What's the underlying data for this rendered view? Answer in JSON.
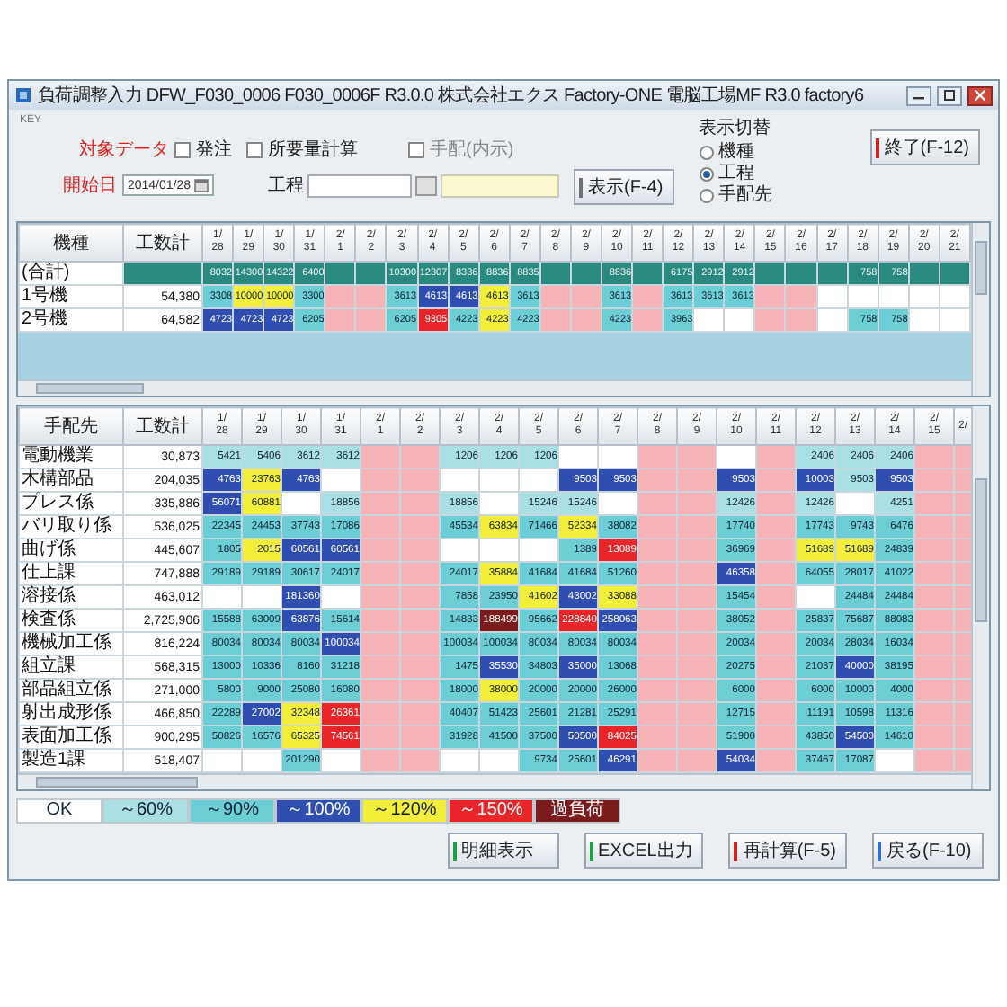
{
  "window": {
    "title": "負荷調整入力 DFW_F030_0006 F030_0006F R3.0.0 株式会社エクス Factory-ONE 電脳工場MF R3.0 factory6"
  },
  "form": {
    "key_label": "KEY",
    "target": {
      "label": "対象データ",
      "option": {
        "label": "発注",
        "checked": false
      }
    },
    "start_date": {
      "label": "開始日",
      "value": "2014/01/28"
    },
    "requirement": {
      "label": "所要量計算",
      "checked": false
    },
    "arrangement": {
      "label": "手配(内示)",
      "checked": false
    },
    "process": {
      "label": "工程"
    },
    "show_button": {
      "label": "表示(F-4)",
      "color": "#707070"
    },
    "display_toggle": {
      "title": "表示切替",
      "options": [
        {
          "label": "機種",
          "selected": false
        },
        {
          "label": "工程",
          "selected": true
        },
        {
          "label": "手配先",
          "selected": false
        }
      ]
    },
    "exit_button": {
      "label": "終了(F-12)",
      "color": "#d02020"
    }
  },
  "upper_table": {
    "columns": {
      "name": "機種",
      "total": "工数計",
      "dates": [
        "1/28",
        "1/29",
        "1/30",
        "1/31",
        "2/1",
        "2/2",
        "2/3",
        "2/4",
        "2/5",
        "2/6",
        "2/7",
        "2/8",
        "2/9",
        "2/10",
        "2/11",
        "2/12",
        "2/13",
        "2/14",
        "2/15",
        "2/16",
        "2/17",
        "2/18",
        "2/19",
        "2/20",
        "2/21"
      ]
    },
    "rows": [
      {
        "kind": "summary",
        "name": "(合計)",
        "cells": [
          {
            "kind": "sum",
            "text": "8032"
          },
          {
            "kind": "sum",
            "text": "14300"
          },
          {
            "kind": "sum",
            "text": "14322"
          },
          {
            "kind": "sum",
            "text": "6400"
          },
          {
            "kind": "sum"
          },
          {
            "kind": "sum"
          },
          {
            "kind": "sum",
            "text": "10300"
          },
          {
            "kind": "sum",
            "text": "12307"
          },
          {
            "kind": "sum",
            "text": "8336"
          },
          {
            "kind": "sum",
            "text": "8836"
          },
          {
            "kind": "sum",
            "text": "8835"
          },
          {
            "kind": "sum"
          },
          {
            "kind": "sum"
          },
          {
            "kind": "sum",
            "text": "8836"
          },
          {
            "kind": "sum"
          },
          {
            "kind": "sum",
            "text": "6175"
          },
          {
            "kind": "sum",
            "text": "2912"
          },
          {
            "kind": "sum",
            "text": "2912"
          },
          {
            "kind": "sum"
          },
          {
            "kind": "sum"
          },
          {
            "kind": "sum"
          },
          {
            "kind": "sum",
            "text": "758"
          },
          {
            "kind": "sum",
            "text": "758"
          },
          {
            "kind": "sum"
          },
          {
            "kind": "sum"
          }
        ]
      },
      {
        "kind": "item",
        "name": "1号機",
        "total": "54,380",
        "cells": [
          {
            "kind": "cyan",
            "text": "3308"
          },
          {
            "kind": "yellow",
            "text": "10000"
          },
          {
            "kind": "yellow",
            "text": "10000"
          },
          {
            "kind": "cyan",
            "text": "3300"
          },
          {
            "kind": "holiday"
          },
          {
            "kind": "holiday"
          },
          {
            "kind": "cyan",
            "text": "3613"
          },
          {
            "kind": "blue",
            "text": "4613"
          },
          {
            "kind": "blue",
            "text": "4613"
          },
          {
            "kind": "yellow",
            "text": "4613"
          },
          {
            "kind": "cyan",
            "text": "3613"
          },
          {
            "kind": "holiday"
          },
          {
            "kind": "holiday"
          },
          {
            "kind": "cyan",
            "text": "3613"
          },
          {
            "kind": "holiday"
          },
          {
            "kind": "cyan",
            "text": "3613"
          },
          {
            "kind": "cyan",
            "text": "3613"
          },
          {
            "kind": "cyan",
            "text": "3613"
          },
          {
            "kind": "holiday"
          },
          {
            "kind": "holiday"
          },
          {
            "kind": "blank"
          },
          {
            "kind": "blank"
          },
          {
            "kind": "blank"
          },
          {
            "kind": "blank"
          },
          {
            "kind": "blank"
          }
        ]
      },
      {
        "kind": "item",
        "name": "2号機",
        "total": "64,582",
        "cells": [
          {
            "kind": "blue",
            "text": "4723"
          },
          {
            "kind": "blue",
            "text": "4723"
          },
          {
            "kind": "blue",
            "text": "4723"
          },
          {
            "kind": "cyan",
            "text": "6205"
          },
          {
            "kind": "holiday"
          },
          {
            "kind": "holiday"
          },
          {
            "kind": "cyan",
            "text": "6205"
          },
          {
            "kind": "red",
            "text": "9305"
          },
          {
            "kind": "cyan",
            "text": "4223"
          },
          {
            "kind": "yellow",
            "text": "4223"
          },
          {
            "kind": "cyan",
            "text": "4223"
          },
          {
            "kind": "holiday"
          },
          {
            "kind": "holiday"
          },
          {
            "kind": "cyan",
            "text": "4223"
          },
          {
            "kind": "holiday"
          },
          {
            "kind": "cyan",
            "text": "3963"
          },
          {
            "kind": "blank"
          },
          {
            "kind": "blank"
          },
          {
            "kind": "holiday"
          },
          {
            "kind": "holiday"
          },
          {
            "kind": "blank"
          },
          {
            "kind": "cyan",
            "text": "758"
          },
          {
            "kind": "cyan",
            "text": "758"
          },
          {
            "kind": "blank"
          },
          {
            "kind": "blank"
          }
        ]
      }
    ]
  },
  "lower_table": {
    "columns": {
      "name": "手配先",
      "total": "工数計",
      "dates": [
        "1/28",
        "1/29",
        "1/30",
        "1/31",
        "2/1",
        "2/2",
        "2/3",
        "2/4",
        "2/5",
        "2/6",
        "2/7",
        "2/8",
        "2/9",
        "2/10",
        "2/11",
        "2/12",
        "2/13",
        "2/14",
        "2/15",
        "2/"
      ]
    },
    "rows": [
      {
        "name": "電動機業",
        "total": "30,873",
        "cells": [
          {
            "kind": "light",
            "text": "5421"
          },
          {
            "kind": "light",
            "text": "5406"
          },
          {
            "kind": "light",
            "text": "3612"
          },
          {
            "kind": "light",
            "text": "3612"
          },
          {
            "kind": "holiday"
          },
          {
            "kind": "holiday"
          },
          {
            "kind": "light",
            "text": "1206"
          },
          {
            "kind": "light",
            "text": "1206"
          },
          {
            "kind": "light",
            "text": "1206"
          },
          {
            "kind": "blank"
          },
          {
            "kind": "blank"
          },
          {
            "kind": "holiday"
          },
          {
            "kind": "holiday"
          },
          {
            "kind": "blank"
          },
          {
            "kind": "holiday"
          },
          {
            "kind": "light",
            "text": "2406"
          },
          {
            "kind": "light",
            "text": "2406"
          },
          {
            "kind": "light",
            "text": "2406"
          },
          {
            "kind": "holiday"
          },
          {
            "kind": "holiday"
          }
        ]
      },
      {
        "name": "木構部品",
        "total": "204,035",
        "cells": [
          {
            "kind": "blue",
            "text": "4763"
          },
          {
            "kind": "yellow",
            "text": "23763"
          },
          {
            "kind": "blue",
            "text": "4763"
          },
          {
            "kind": "blank"
          },
          {
            "kind": "holiday"
          },
          {
            "kind": "holiday"
          },
          {
            "kind": "blank"
          },
          {
            "kind": "blank"
          },
          {
            "kind": "blank"
          },
          {
            "kind": "blue",
            "text": "9503"
          },
          {
            "kind": "blue",
            "text": "9503"
          },
          {
            "kind": "holiday"
          },
          {
            "kind": "holiday"
          },
          {
            "kind": "blue",
            "text": "9503"
          },
          {
            "kind": "holiday"
          },
          {
            "kind": "blue",
            "text": "10003"
          },
          {
            "kind": "light",
            "text": "9503"
          },
          {
            "kind": "blue",
            "text": "9503"
          },
          {
            "kind": "holiday"
          },
          {
            "kind": "holiday"
          }
        ]
      },
      {
        "name": "プレス係",
        "total": "335,886",
        "cells": [
          {
            "kind": "blue",
            "text": "56071"
          },
          {
            "kind": "yellow",
            "text": "60881"
          },
          {
            "kind": "blank"
          },
          {
            "kind": "light",
            "text": "18856"
          },
          {
            "kind": "holiday"
          },
          {
            "kind": "holiday"
          },
          {
            "kind": "light",
            "text": "18856"
          },
          {
            "kind": "blank"
          },
          {
            "kind": "light",
            "text": "15246"
          },
          {
            "kind": "light",
            "text": "15246"
          },
          {
            "kind": "blank"
          },
          {
            "kind": "holiday"
          },
          {
            "kind": "holiday"
          },
          {
            "kind": "light",
            "text": "12426"
          },
          {
            "kind": "holiday"
          },
          {
            "kind": "light",
            "text": "12426"
          },
          {
            "kind": "blank"
          },
          {
            "kind": "light",
            "text": "4251"
          },
          {
            "kind": "holiday"
          },
          {
            "kind": "holiday"
          }
        ]
      },
      {
        "name": "バリ取り係",
        "total": "536,025",
        "cells": [
          {
            "kind": "cyan",
            "text": "22345"
          },
          {
            "kind": "cyan",
            "text": "24453"
          },
          {
            "kind": "cyan",
            "text": "37743"
          },
          {
            "kind": "cyan",
            "text": "17086"
          },
          {
            "kind": "holiday"
          },
          {
            "kind": "holiday"
          },
          {
            "kind": "cyan",
            "text": "45534"
          },
          {
            "kind": "yellow",
            "text": "63834"
          },
          {
            "kind": "cyan",
            "text": "71466"
          },
          {
            "kind": "yellow",
            "text": "52334"
          },
          {
            "kind": "cyan",
            "text": "38082"
          },
          {
            "kind": "holiday"
          },
          {
            "kind": "holiday"
          },
          {
            "kind": "cyan",
            "text": "17740"
          },
          {
            "kind": "holiday"
          },
          {
            "kind": "cyan",
            "text": "17743"
          },
          {
            "kind": "cyan",
            "text": "9743"
          },
          {
            "kind": "cyan",
            "text": "6476"
          },
          {
            "kind": "holiday"
          },
          {
            "kind": "holiday"
          }
        ]
      },
      {
        "name": "曲げ係",
        "total": "445,607",
        "cells": [
          {
            "kind": "cyan",
            "text": "1805"
          },
          {
            "kind": "yellow",
            "text": "2015"
          },
          {
            "kind": "blue",
            "text": "60561"
          },
          {
            "kind": "blue",
            "text": "60561"
          },
          {
            "kind": "holiday"
          },
          {
            "kind": "holiday"
          },
          {
            "kind": "blank"
          },
          {
            "kind": "blank"
          },
          {
            "kind": "blank"
          },
          {
            "kind": "cyan",
            "text": "1389"
          },
          {
            "kind": "red",
            "text": "13089"
          },
          {
            "kind": "holiday"
          },
          {
            "kind": "holiday"
          },
          {
            "kind": "cyan",
            "text": "36969"
          },
          {
            "kind": "holiday"
          },
          {
            "kind": "yellow",
            "text": "51689"
          },
          {
            "kind": "yellow",
            "text": "51689"
          },
          {
            "kind": "cyan",
            "text": "24839"
          },
          {
            "kind": "holiday"
          },
          {
            "kind": "holiday"
          }
        ]
      },
      {
        "name": "仕上課",
        "total": "747,888",
        "cells": [
          {
            "kind": "cyan",
            "text": "29189"
          },
          {
            "kind": "cyan",
            "text": "29189"
          },
          {
            "kind": "cyan",
            "text": "30617"
          },
          {
            "kind": "cyan",
            "text": "24017"
          },
          {
            "kind": "holiday"
          },
          {
            "kind": "holiday"
          },
          {
            "kind": "cyan",
            "text": "24017"
          },
          {
            "kind": "yellow",
            "text": "35884"
          },
          {
            "kind": "cyan",
            "text": "41684"
          },
          {
            "kind": "cyan",
            "text": "41684"
          },
          {
            "kind": "cyan",
            "text": "51260"
          },
          {
            "kind": "holiday"
          },
          {
            "kind": "holiday"
          },
          {
            "kind": "blue",
            "text": "46358"
          },
          {
            "kind": "holiday"
          },
          {
            "kind": "cyan",
            "text": "64055"
          },
          {
            "kind": "cyan",
            "text": "28017"
          },
          {
            "kind": "cyan",
            "text": "41022"
          },
          {
            "kind": "holiday"
          },
          {
            "kind": "holiday"
          }
        ]
      },
      {
        "name": "溶接係",
        "total": "463,012",
        "cells": [
          {
            "kind": "blank"
          },
          {
            "kind": "blank"
          },
          {
            "kind": "blue",
            "text": "181360"
          },
          {
            "kind": "blank"
          },
          {
            "kind": "holiday"
          },
          {
            "kind": "holiday"
          },
          {
            "kind": "cyan",
            "text": "7858"
          },
          {
            "kind": "cyan",
            "text": "23950"
          },
          {
            "kind": "yellow",
            "text": "41602"
          },
          {
            "kind": "blue",
            "text": "43002"
          },
          {
            "kind": "yellow",
            "text": "33088"
          },
          {
            "kind": "holiday"
          },
          {
            "kind": "holiday"
          },
          {
            "kind": "cyan",
            "text": "15454"
          },
          {
            "kind": "holiday"
          },
          {
            "kind": "blank"
          },
          {
            "kind": "cyan",
            "text": "24484"
          },
          {
            "kind": "cyan",
            "text": "24484"
          },
          {
            "kind": "holiday"
          },
          {
            "kind": "holiday"
          }
        ]
      },
      {
        "name": "検査係",
        "total": "2,725,906",
        "cells": [
          {
            "kind": "cyan",
            "text": "15588"
          },
          {
            "kind": "cyan",
            "text": "63009"
          },
          {
            "kind": "blue",
            "text": "63876"
          },
          {
            "kind": "cyan",
            "text": "15614"
          },
          {
            "kind": "holiday"
          },
          {
            "kind": "holiday"
          },
          {
            "kind": "cyan",
            "text": "14833"
          },
          {
            "kind": "over",
            "text": "188499"
          },
          {
            "kind": "cyan",
            "text": "95662"
          },
          {
            "kind": "red",
            "text": "228840"
          },
          {
            "kind": "blue",
            "text": "258063"
          },
          {
            "kind": "holiday"
          },
          {
            "kind": "holiday"
          },
          {
            "kind": "cyan",
            "text": "38052"
          },
          {
            "kind": "holiday"
          },
          {
            "kind": "cyan",
            "text": "25837"
          },
          {
            "kind": "cyan",
            "text": "75687"
          },
          {
            "kind": "cyan",
            "text": "88083"
          },
          {
            "kind": "holiday"
          },
          {
            "kind": "holiday"
          }
        ]
      },
      {
        "name": "機械加工係",
        "total": "816,224",
        "cells": [
          {
            "kind": "cyan",
            "text": "80034"
          },
          {
            "kind": "cyan",
            "text": "80034"
          },
          {
            "kind": "cyan",
            "text": "80034"
          },
          {
            "kind": "blue",
            "text": "100034"
          },
          {
            "kind": "holiday"
          },
          {
            "kind": "holiday"
          },
          {
            "kind": "cyan",
            "text": "100034"
          },
          {
            "kind": "cyan",
            "text": "100034"
          },
          {
            "kind": "cyan",
            "text": "80034"
          },
          {
            "kind": "cyan",
            "text": "80034"
          },
          {
            "kind": "cyan",
            "text": "80034"
          },
          {
            "kind": "holiday"
          },
          {
            "kind": "holiday"
          },
          {
            "kind": "cyan",
            "text": "20034"
          },
          {
            "kind": "holiday"
          },
          {
            "kind": "cyan",
            "text": "20034"
          },
          {
            "kind": "cyan",
            "text": "28034"
          },
          {
            "kind": "cyan",
            "text": "16034"
          },
          {
            "kind": "holiday"
          },
          {
            "kind": "holiday"
          }
        ]
      },
      {
        "name": "組立課",
        "total": "568,315",
        "cells": [
          {
            "kind": "cyan",
            "text": "13000"
          },
          {
            "kind": "cyan",
            "text": "10336"
          },
          {
            "kind": "cyan",
            "text": "8160"
          },
          {
            "kind": "cyan",
            "text": "31218"
          },
          {
            "kind": "holiday"
          },
          {
            "kind": "holiday"
          },
          {
            "kind": "cyan",
            "text": "1475"
          },
          {
            "kind": "blue",
            "text": "35530"
          },
          {
            "kind": "cyan",
            "text": "34803"
          },
          {
            "kind": "blue",
            "text": "35000"
          },
          {
            "kind": "cyan",
            "text": "13068"
          },
          {
            "kind": "holiday"
          },
          {
            "kind": "holiday"
          },
          {
            "kind": "cyan",
            "text": "20275"
          },
          {
            "kind": "holiday"
          },
          {
            "kind": "cyan",
            "text": "21037"
          },
          {
            "kind": "blue",
            "text": "40000"
          },
          {
            "kind": "cyan",
            "text": "38195"
          },
          {
            "kind": "holiday"
          },
          {
            "kind": "holiday"
          }
        ]
      },
      {
        "name": "部品組立係",
        "total": "271,000",
        "cells": [
          {
            "kind": "cyan",
            "text": "5800"
          },
          {
            "kind": "cyan",
            "text": "9000"
          },
          {
            "kind": "cyan",
            "text": "25080"
          },
          {
            "kind": "cyan",
            "text": "16080"
          },
          {
            "kind": "holiday"
          },
          {
            "kind": "holiday"
          },
          {
            "kind": "cyan",
            "text": "18000"
          },
          {
            "kind": "yellow",
            "text": "38000"
          },
          {
            "kind": "cyan",
            "text": "20000"
          },
          {
            "kind": "cyan",
            "text": "20000"
          },
          {
            "kind": "cyan",
            "text": "26000"
          },
          {
            "kind": "holiday"
          },
          {
            "kind": "holiday"
          },
          {
            "kind": "cyan",
            "text": "6000"
          },
          {
            "kind": "holiday"
          },
          {
            "kind": "cyan",
            "text": "6000"
          },
          {
            "kind": "cyan",
            "text": "10000"
          },
          {
            "kind": "cyan",
            "text": "4000"
          },
          {
            "kind": "holiday"
          },
          {
            "kind": "holiday"
          }
        ]
      },
      {
        "name": "射出成形係",
        "total": "466,850",
        "cells": [
          {
            "kind": "cyan",
            "text": "22289"
          },
          {
            "kind": "blue",
            "text": "27002"
          },
          {
            "kind": "yellow",
            "text": "32348"
          },
          {
            "kind": "red",
            "text": "26361"
          },
          {
            "kind": "holiday"
          },
          {
            "kind": "holiday"
          },
          {
            "kind": "cyan",
            "text": "40407"
          },
          {
            "kind": "cyan",
            "text": "51423"
          },
          {
            "kind": "cyan",
            "text": "25601"
          },
          {
            "kind": "cyan",
            "text": "21281"
          },
          {
            "kind": "cyan",
            "text": "25291"
          },
          {
            "kind": "holiday"
          },
          {
            "kind": "holiday"
          },
          {
            "kind": "cyan",
            "text": "12715"
          },
          {
            "kind": "holiday"
          },
          {
            "kind": "cyan",
            "text": "11191"
          },
          {
            "kind": "cyan",
            "text": "10598"
          },
          {
            "kind": "cyan",
            "text": "11316"
          },
          {
            "kind": "holiday"
          },
          {
            "kind": "holiday"
          }
        ]
      },
      {
        "name": "表面加工係",
        "total": "900,295",
        "cells": [
          {
            "kind": "cyan",
            "text": "50826"
          },
          {
            "kind": "cyan",
            "text": "16576"
          },
          {
            "kind": "yellow",
            "text": "65325"
          },
          {
            "kind": "red",
            "text": "74561"
          },
          {
            "kind": "holiday"
          },
          {
            "kind": "holiday"
          },
          {
            "kind": "cyan",
            "text": "31928"
          },
          {
            "kind": "cyan",
            "text": "41500"
          },
          {
            "kind": "cyan",
            "text": "37500"
          },
          {
            "kind": "blue",
            "text": "50500"
          },
          {
            "kind": "red",
            "text": "84025"
          },
          {
            "kind": "holiday"
          },
          {
            "kind": "holiday"
          },
          {
            "kind": "cyan",
            "text": "51900"
          },
          {
            "kind": "holiday"
          },
          {
            "kind": "cyan",
            "text": "43850"
          },
          {
            "kind": "blue",
            "text": "54500"
          },
          {
            "kind": "cyan",
            "text": "14610"
          },
          {
            "kind": "holiday"
          },
          {
            "kind": "holiday"
          }
        ]
      },
      {
        "name": "製造1課",
        "total": "518,407",
        "cells": [
          {
            "kind": "blank"
          },
          {
            "kind": "blank"
          },
          {
            "kind": "cyan",
            "text": "201290"
          },
          {
            "kind": "blank"
          },
          {
            "kind": "holiday"
          },
          {
            "kind": "holiday"
          },
          {
            "kind": "blank"
          },
          {
            "kind": "blank"
          },
          {
            "kind": "cyan",
            "text": "9734"
          },
          {
            "kind": "cyan",
            "text": "25601"
          },
          {
            "kind": "blue",
            "text": "46291"
          },
          {
            "kind": "holiday"
          },
          {
            "kind": "holiday"
          },
          {
            "kind": "blue",
            "text": "54034"
          },
          {
            "kind": "holiday"
          },
          {
            "kind": "cyan",
            "text": "37467"
          },
          {
            "kind": "cyan",
            "text": "17087"
          },
          {
            "kind": "blank"
          },
          {
            "kind": "holiday"
          },
          {
            "kind": "holiday"
          }
        ]
      }
    ]
  },
  "legend": [
    {
      "label": "OK",
      "kind": "blank"
    },
    {
      "label": "～60%",
      "kind": "light"
    },
    {
      "label": "～90%",
      "kind": "cyan"
    },
    {
      "label": "～100%",
      "kind": "blue"
    },
    {
      "label": "～120%",
      "kind": "yellow"
    },
    {
      "label": "～150%",
      "kind": "red"
    },
    {
      "label": "過負荷",
      "kind": "over"
    }
  ],
  "buttons": [
    {
      "label": "明細表示",
      "color": "#20a040"
    },
    {
      "label": "EXCEL出力",
      "color": "#20a040"
    },
    {
      "label": "再計算(F-5)",
      "color": "#d02020"
    },
    {
      "label": "戻る(F-10)",
      "color": "#3070d0"
    }
  ]
}
